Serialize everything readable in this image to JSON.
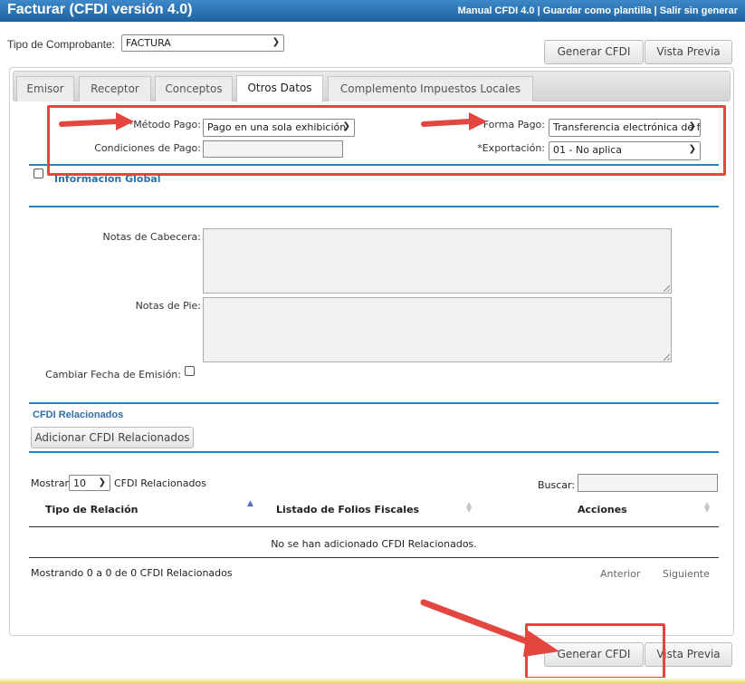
{
  "header": {
    "title": "Facturar (CFDI versión 4.0)",
    "link_manual": "Manual CFDI 4.0",
    "link_save_template": "Guardar como plantilla",
    "link_exit": "Salir sin generar",
    "separator": "|"
  },
  "top": {
    "tipo_label": "Tipo de Comprobante:",
    "tipo_value": "FACTURA",
    "generar_label": "Generar CFDI",
    "vista_label": "Vista Previa"
  },
  "tabs": [
    {
      "label": "Emisor",
      "active": false
    },
    {
      "label": "Receptor",
      "active": false
    },
    {
      "label": "Conceptos",
      "active": false
    },
    {
      "label": "Otros Datos",
      "active": true
    },
    {
      "label": "Complemento Impuestos Locales",
      "active": false
    }
  ],
  "form": {
    "metodo_label": "*Método Pago:",
    "metodo_value": "Pago en una sola exhibición",
    "forma_label": "*Forma Pago:",
    "forma_value": "Transferencia electrónica de fondos",
    "condiciones_label": "Condiciones de Pago:",
    "condiciones_value": "",
    "exportacion_label": "*Exportación:",
    "exportacion_value": "01 - No aplica",
    "info_global_label": "Información Global",
    "notas_cabecera_label": "Notas de Cabecera:",
    "notas_pie_label": "Notas de Pie:",
    "cambiar_fecha_label": "Cambiar Fecha de Emisión:"
  },
  "cfdi_rel": {
    "section_title": "CFDI Relacionados",
    "add_button": "Adicionar CFDI Relacionados",
    "show_label": "Mostrar",
    "show_value": "10",
    "show_suffix": "CFDI Relacionados",
    "search_label": "Buscar:",
    "search_value": "",
    "columns": [
      "Tipo de Relación",
      "Listado de Folios Fiscales",
      "Acciones"
    ],
    "empty_message": "No se han adicionado CFDI Relacionados.",
    "info": "Mostrando 0 a 0 de 0 CFDI Relacionados",
    "prev_label": "Anterior",
    "next_label": "Siguiente"
  },
  "bottom": {
    "generar_label": "Generar CFDI",
    "vista_label": "Vista Previa"
  },
  "colors": {
    "title_bar": "#2a73b5",
    "accent_line": "#2e82b8",
    "annotation_red": "#e2463f"
  },
  "icons": [
    "chevron-down-icon",
    "arrow-annotation-icon",
    "sort-icon",
    "resize-grip-icon"
  ]
}
